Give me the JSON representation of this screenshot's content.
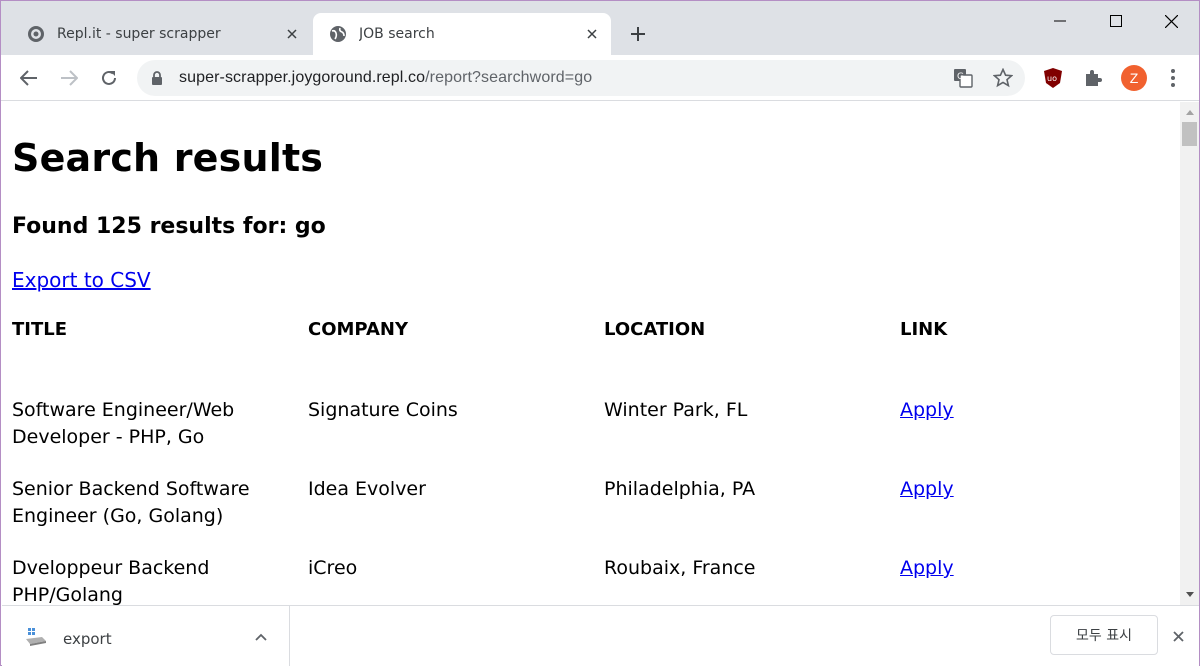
{
  "browser": {
    "tabs": [
      {
        "label": "Repl.it - super scrapper",
        "favicon": "replit-icon",
        "active": false
      },
      {
        "label": "JOB search",
        "favicon": "globe-icon",
        "active": true
      }
    ],
    "url": {
      "host": "super-scrapper.joygoround.repl.co",
      "path": "/report?searchword=go"
    },
    "profile_initial": "Z",
    "profile_color": "#f1612f"
  },
  "page": {
    "title": "Search results",
    "summary": "Found 125 results for: go",
    "export_link": "Export to CSV",
    "table": {
      "headers": [
        "TITLE",
        "COMPANY",
        "LOCATION",
        "LINK"
      ],
      "rows": [
        {
          "title": "Software Engineer/Web Developer - PHP, Go",
          "company": "Signature Coins",
          "location": "Winter Park, FL",
          "link": "Apply"
        },
        {
          "title": "Senior Backend Software Engineer (Go, Golang)",
          "company": "Idea Evolver",
          "location": "Philadelphia, PA",
          "link": "Apply"
        },
        {
          "title": "Dveloppeur Backend PHP/Golang",
          "company": "iCreo",
          "location": "Roubaix, France",
          "link": "Apply"
        }
      ]
    }
  },
  "downloads": {
    "file_name": "export",
    "show_all": "모두 표시"
  },
  "colors": {
    "link": "#0000ee",
    "visited_link": "#551a8b",
    "tabstrip": "#dee1e6",
    "window_border": "#b48ec4"
  }
}
